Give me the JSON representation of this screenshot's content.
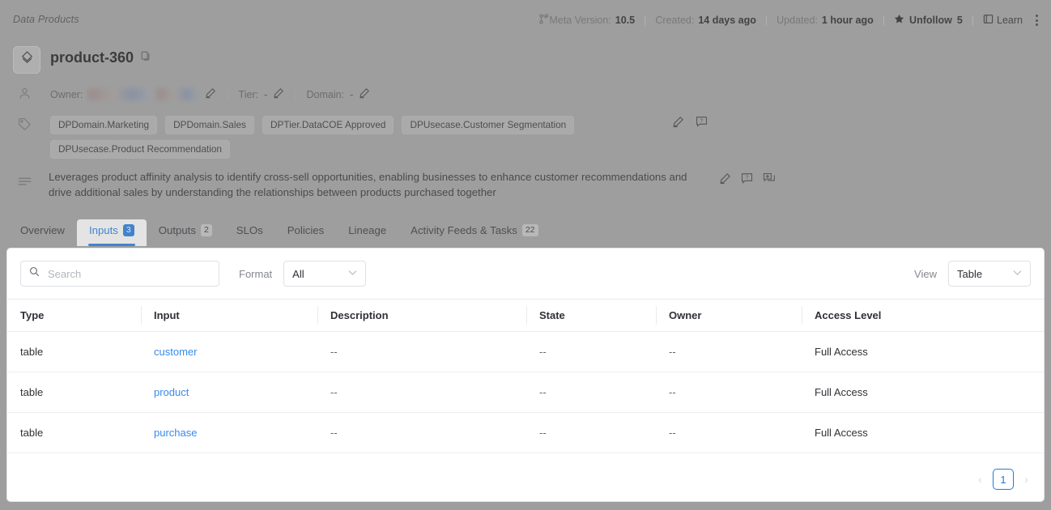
{
  "breadcrumb": "Data Products",
  "header": {
    "meta_version_label": "Meta Version:",
    "meta_version_value": "10.5",
    "created_label": "Created:",
    "created_value": "14 days ago",
    "updated_label": "Updated:",
    "updated_value": "1 hour ago",
    "follow_label": "Unfollow",
    "follow_count": "5",
    "learn_label": "Learn"
  },
  "title": {
    "name": "product-360"
  },
  "owner_row": {
    "owner_label": "Owner:",
    "owner_value": "",
    "tier_label": "Tier:",
    "tier_value": "-",
    "domain_label": "Domain:",
    "domain_value": "-"
  },
  "tags": [
    "DPDomain.Marketing",
    "DPDomain.Sales",
    "DPTier.DataCOE Approved",
    "DPUsecase.Customer Segmentation",
    "DPUsecase.Product Recommendation"
  ],
  "description": "Leverages product affinity analysis to identify cross-sell opportunities, enabling businesses to enhance customer recommendations and drive additional sales by understanding the relationships between products purchased together",
  "tabs": [
    {
      "label": "Overview",
      "count": "",
      "active": false
    },
    {
      "label": "Inputs",
      "count": "3",
      "active": true
    },
    {
      "label": "Outputs",
      "count": "2",
      "active": false
    },
    {
      "label": "SLOs",
      "count": "",
      "active": false
    },
    {
      "label": "Policies",
      "count": "",
      "active": false
    },
    {
      "label": "Lineage",
      "count": "",
      "active": false
    },
    {
      "label": "Activity Feeds & Tasks",
      "count": "22",
      "active": false
    }
  ],
  "filters": {
    "search_placeholder": "Search",
    "search_value": "",
    "format_label": "Format",
    "format_value": "All",
    "view_label": "View",
    "view_value": "Table"
  },
  "table": {
    "columns": [
      "Type",
      "Input",
      "Description",
      "State",
      "Owner",
      "Access Level"
    ],
    "rows": [
      {
        "type": "table",
        "input": "customer",
        "description": "--",
        "state": "--",
        "owner": "--",
        "access_level": "Full Access"
      },
      {
        "type": "table",
        "input": "product",
        "description": "--",
        "state": "--",
        "owner": "--",
        "access_level": "Full Access"
      },
      {
        "type": "table",
        "input": "purchase",
        "description": "--",
        "state": "--",
        "owner": "--",
        "access_level": "Full Access"
      }
    ]
  },
  "pagination": {
    "prev": "‹",
    "current_page": "1",
    "next": "›"
  },
  "colors": {
    "accent": "#1f7ae0",
    "link": "#3a8ae8",
    "overlay": "#9e9e9e",
    "panel_bg": "#ffffff",
    "border": "#e4e6ea"
  }
}
